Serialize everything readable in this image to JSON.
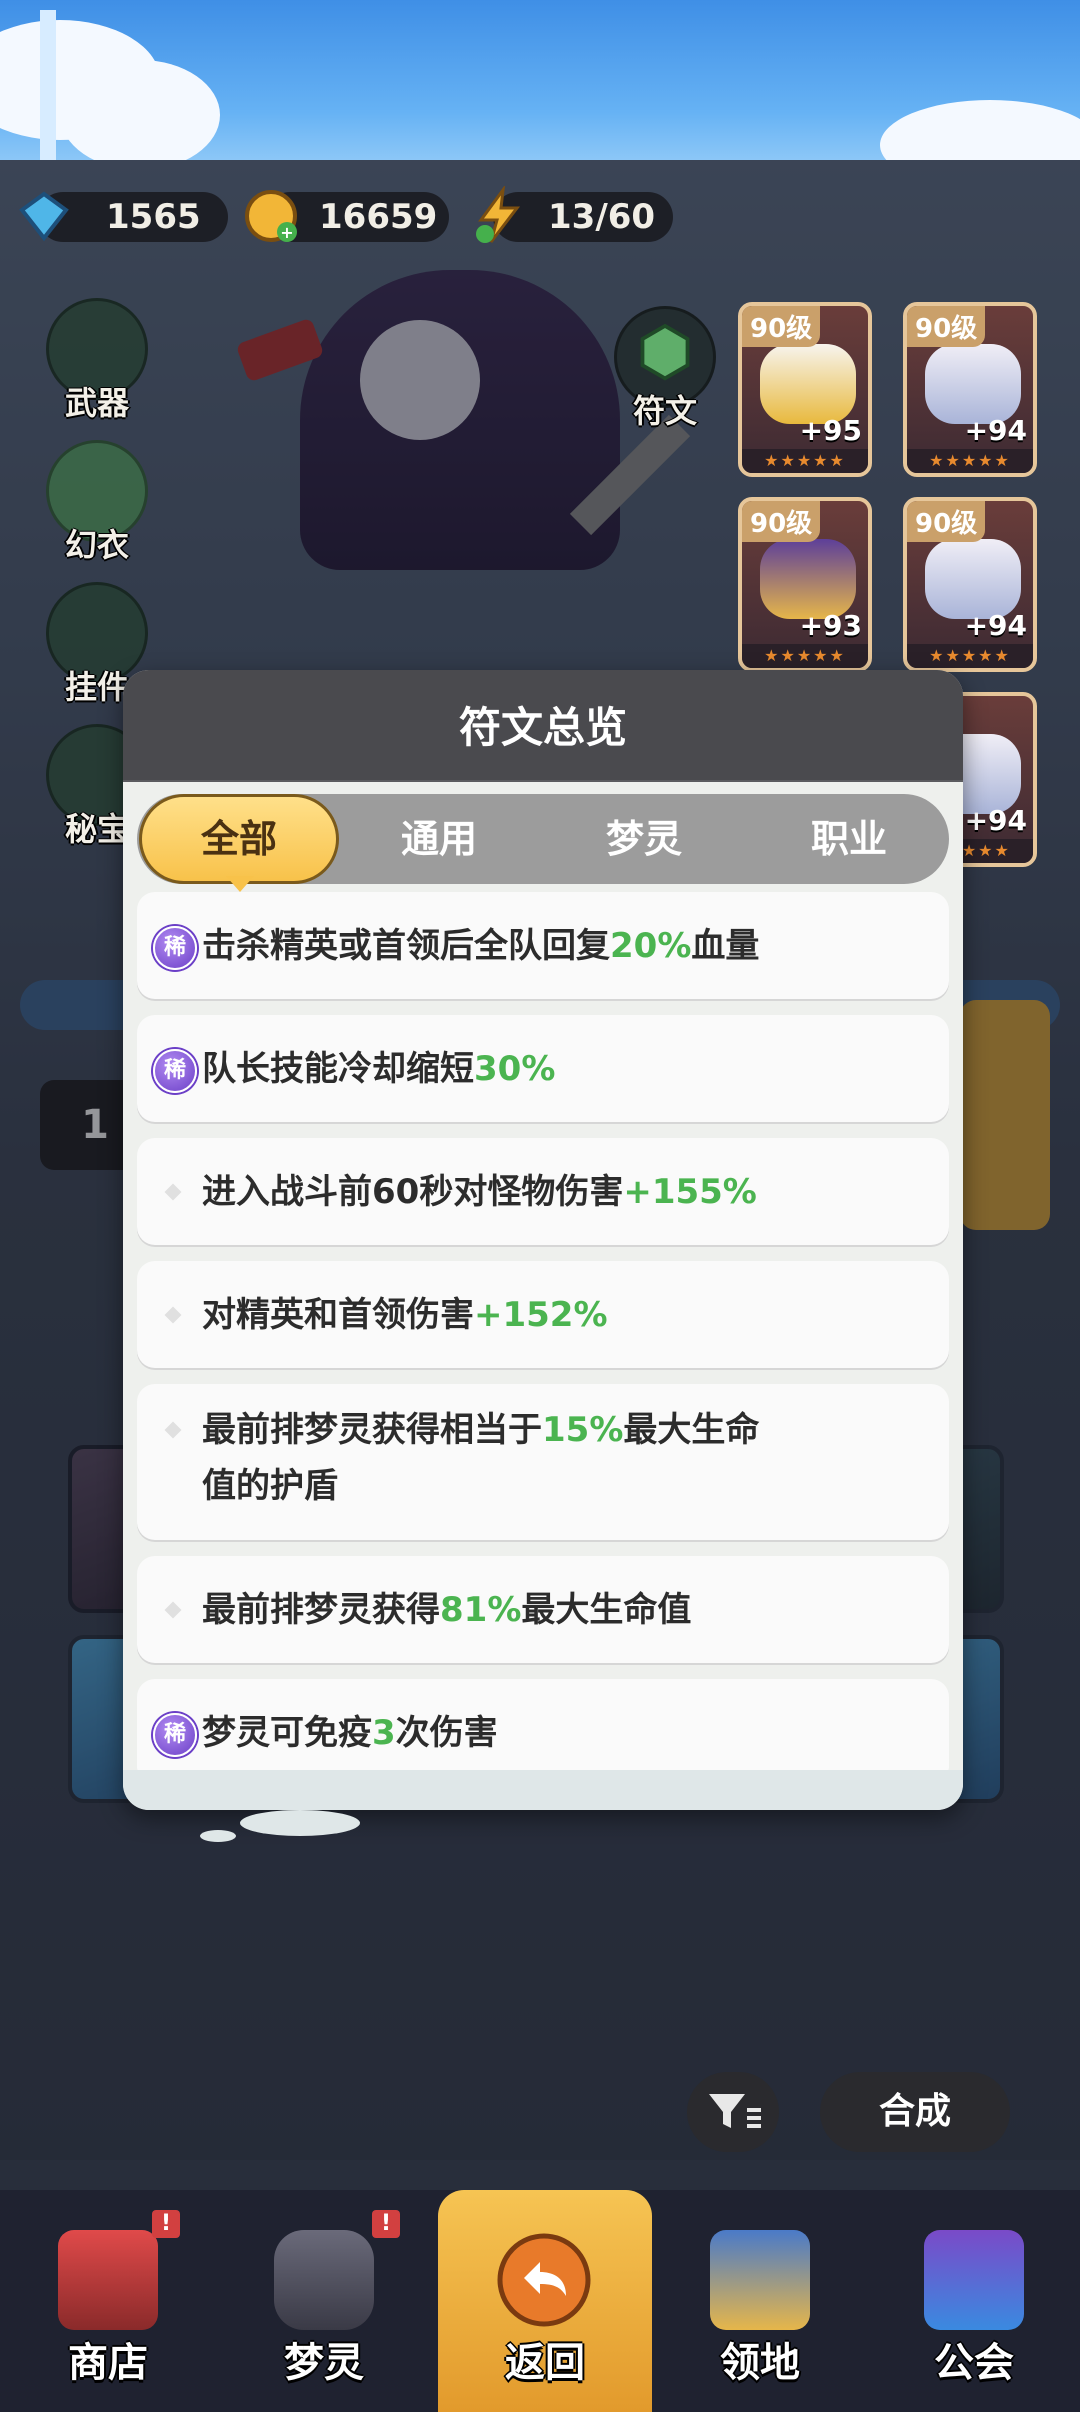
{
  "currency": {
    "gems": "1565",
    "gold": "16659",
    "energy": "13/60"
  },
  "side_menu": [
    "武器",
    "幻衣",
    "挂件",
    "秘宝"
  ],
  "rune_button": "符文",
  "equipment": [
    {
      "level": "90级",
      "plus": "+95"
    },
    {
      "level": "90级",
      "plus": "+94"
    },
    {
      "level": "90级",
      "plus": "+93"
    },
    {
      "level": "90级",
      "plus": "+94"
    },
    {
      "level": "",
      "plus": "+94"
    }
  ],
  "side_number": "1",
  "modal": {
    "title": "符文总览",
    "tabs": [
      "全部",
      "通用",
      "梦灵",
      "职业"
    ],
    "active_tab": "全部",
    "rare_badge": "稀",
    "runes": [
      {
        "rare": true,
        "parts": [
          {
            "t": "击杀精英或首领后全队回复"
          },
          {
            "t": "20%",
            "hl": true
          },
          {
            "t": "血量"
          }
        ]
      },
      {
        "rare": true,
        "parts": [
          {
            "t": "队长技能冷却缩短"
          },
          {
            "t": "30%",
            "hl": true
          }
        ]
      },
      {
        "rare": false,
        "parts": [
          {
            "t": "进入战斗前60秒对怪物伤害"
          },
          {
            "t": "+155%",
            "hl": true
          }
        ]
      },
      {
        "rare": false,
        "parts": [
          {
            "t": "对精英和首领伤害"
          },
          {
            "t": "+152%",
            "hl": true
          }
        ]
      },
      {
        "rare": false,
        "parts": [
          {
            "t": "最前排梦灵获得相当于"
          },
          {
            "t": "15%",
            "hl": true
          },
          {
            "t": "最大生命"
          }
        ],
        "line2": "值的护盾"
      },
      {
        "rare": false,
        "parts": [
          {
            "t": "最前排梦灵获得"
          },
          {
            "t": "81%",
            "hl": true
          },
          {
            "t": "最大生命值"
          }
        ]
      },
      {
        "rare": true,
        "parts": [
          {
            "t": "梦灵可免疫"
          },
          {
            "t": "3",
            "hl": true
          },
          {
            "t": "次伤害"
          }
        ]
      }
    ]
  },
  "actions": {
    "synthesize": "合成"
  },
  "bottom_nav": [
    {
      "label": "商店",
      "badge": "!"
    },
    {
      "label": "梦灵",
      "badge": "!"
    },
    {
      "label": "返回",
      "badge": ""
    },
    {
      "label": "领地",
      "badge": ""
    },
    {
      "label": "公会",
      "badge": ""
    }
  ],
  "colors": {
    "highlight": "#4bb450",
    "active_tab": "#f8c24a",
    "rare_badge": "#6b3fc7",
    "header": "#4a4a4e"
  }
}
